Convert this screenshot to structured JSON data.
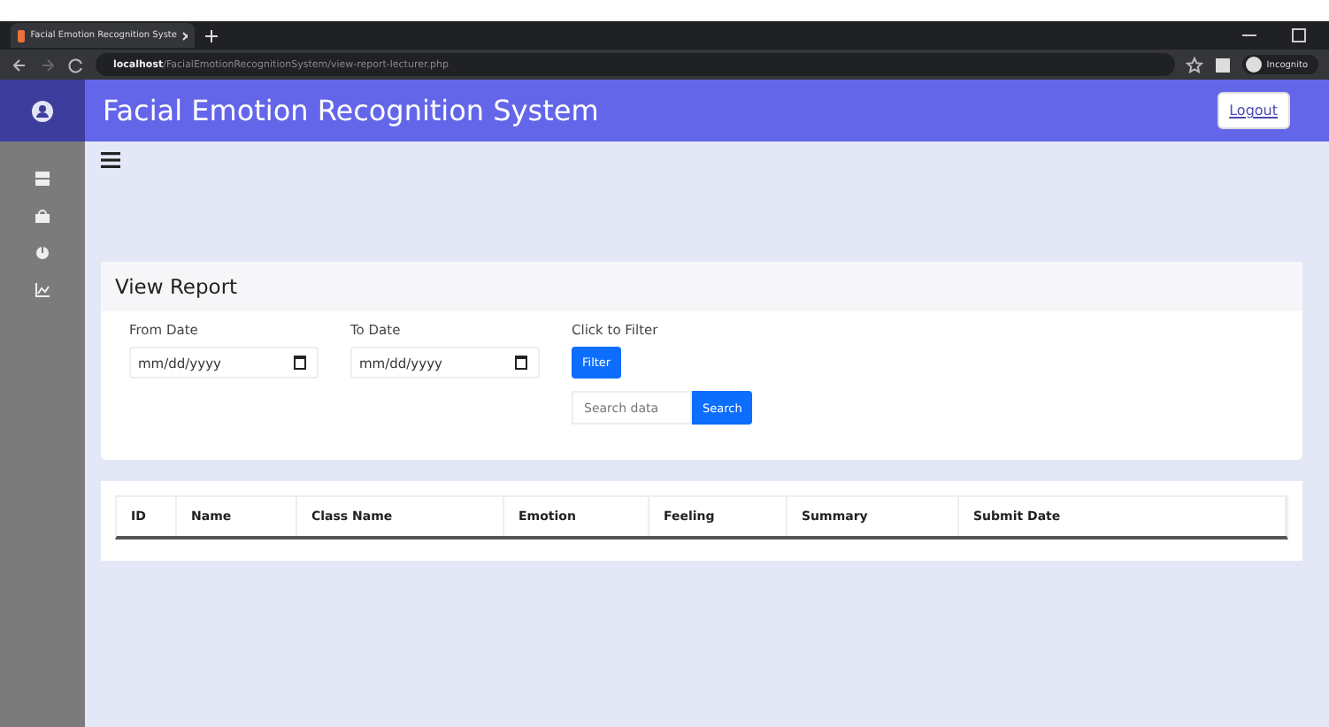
{
  "browser": {
    "tab_title": "Facial Emotion Recognition Syste",
    "url_host": "localhost",
    "url_path": "/FacialEmotionRecognitionSystem/view-report-lecturer.php",
    "profile": "Incognito"
  },
  "header": {
    "title": "Facial Emotion Recognition System",
    "logout": "Logout"
  },
  "report": {
    "title": "View Report",
    "from_label": "From Date",
    "from_placeholder": "mm/dd/yyyy",
    "to_label": "To Date",
    "to_placeholder": "mm/dd/yyyy",
    "filter_label": "Click to Filter",
    "filter_button": "Filter",
    "search_placeholder": "Search data",
    "search_button": "Search"
  },
  "table": {
    "columns": [
      "ID",
      "Name",
      "Class Name",
      "Emotion",
      "Feeling",
      "Summary",
      "Submit Date"
    ]
  }
}
